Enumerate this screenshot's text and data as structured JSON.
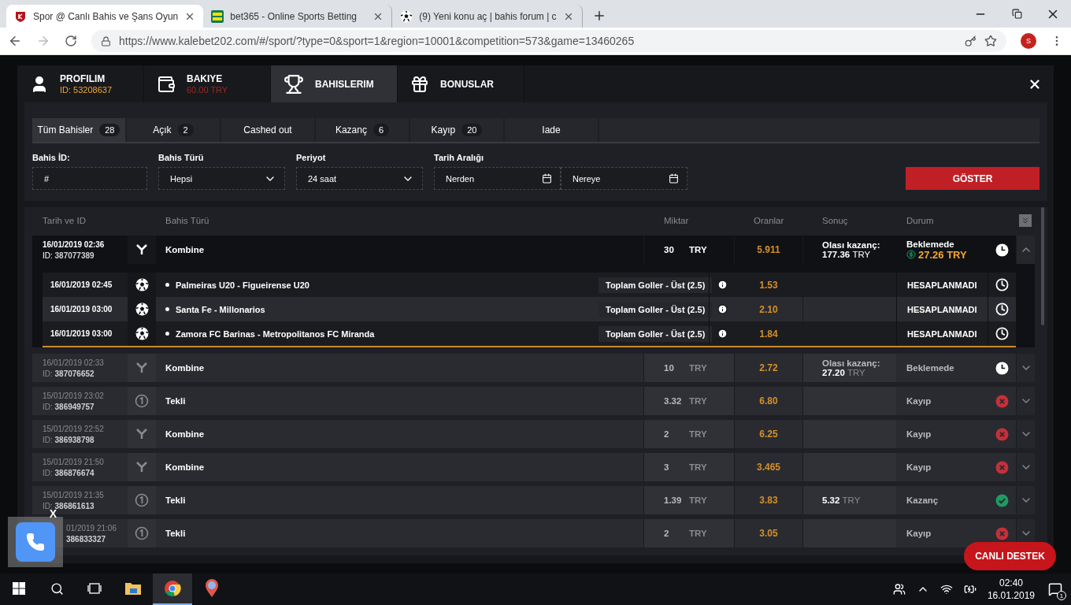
{
  "browser": {
    "tabs": [
      {
        "kind": "kale",
        "title": "Spor @ Canlı Bahis ve Şans Oyun",
        "selected": true
      },
      {
        "kind": "bet365",
        "title": "bet365 - Online Sports Betting",
        "selected": false
      },
      {
        "kind": "ball",
        "title": "(9) Yeni konu aç | bahis forum | c",
        "selected": false
      }
    ],
    "url": "https://www.kalebet202.com/#/sport/?type=0&sport=1&region=10001&competition=573&game=13460265",
    "profile_initial": "S"
  },
  "header_tabs": [
    {
      "kind": "profile",
      "label": "PROFILIM",
      "sub": "ID: 53208637",
      "selected": false
    },
    {
      "kind": "balance",
      "label": "BAKIYE",
      "sub": "60.00 TRY",
      "selected": false
    },
    {
      "kind": "bets",
      "label": "BAHISLERIM",
      "selected": true
    },
    {
      "kind": "bonus",
      "label": "BONUSLAR",
      "selected": false
    }
  ],
  "filter_tabs": [
    {
      "label": "Tüm Bahisler",
      "count": "28",
      "selected": true
    },
    {
      "label": "Açık",
      "count": "2",
      "selected": false
    },
    {
      "label": "Cashed out",
      "selected": false
    },
    {
      "label": "Kazanç",
      "count": "6",
      "selected": false
    },
    {
      "label": "Kayıp",
      "count": "20",
      "selected": false
    },
    {
      "label": "Iade",
      "selected": false
    }
  ],
  "filters": [
    {
      "kind": "text",
      "label": "Bahis İD:",
      "value": "#"
    },
    {
      "kind": "select",
      "label": "Bahis Türü",
      "value": "Hepsi"
    },
    {
      "kind": "select",
      "label": "Periyot",
      "value": "24 saat"
    },
    {
      "kind": "range",
      "label": "Tarih Aralığı",
      "from": "Nerden",
      "to": "Nereye"
    }
  ],
  "show_button": "GÖSTER",
  "table": {
    "columns": [
      "Tarih ve ID",
      "Bahis Türü",
      "Miktar",
      "Oranlar",
      "Sonuç",
      "Durum"
    ],
    "rows": [
      {
        "date": "16/01/2019 02:36",
        "id_label": "ID:",
        "id": "387077389",
        "kind": "combo",
        "type": "Kombine",
        "amount": "30",
        "currency": "TRY",
        "odds": "5.911",
        "result_label": "Olası kazanç:",
        "result_amount": "177.36",
        "result_currency": "TRY",
        "status": {
          "text": "Beklemede",
          "kind": "pending"
        },
        "cashout": "27.26 TRY",
        "expanded": true,
        "cut": false,
        "legs": [
          {
            "date": "16/01/2019 02:45",
            "match": "Palmeiras U20 - Figueirense U20",
            "market": "Toplam Goller - Üst (2.5)",
            "odds": "1.53",
            "status": "HESAPLANMADI",
            "highlighted": false
          },
          {
            "date": "16/01/2019 03:00",
            "match": "Santa Fe - Millonarios",
            "market": "Toplam Goller - Üst (2.5)",
            "odds": "2.10",
            "status": "HESAPLANMADI",
            "highlighted": true
          },
          {
            "date": "16/01/2019 03:00",
            "match": "Zamora FC Barinas - Metropolitanos FC Miranda",
            "market": "Toplam Goller - Üst (2.5)",
            "odds": "1.84",
            "status": "HESAPLANMADI",
            "highlighted": false
          }
        ]
      },
      {
        "date": "16/01/2019 02:33",
        "id_label": "ID:",
        "id": "387076652",
        "kind": "combo",
        "type": "Kombine",
        "amount": "10",
        "currency": "TRY",
        "odds": "2.72",
        "result_label": "Olası kazanç:",
        "result_amount": "27.20",
        "result_currency": "TRY",
        "status": {
          "text": "Beklemede",
          "kind": "pending"
        },
        "expanded": false,
        "cut": false
      },
      {
        "date": "15/01/2019 23:02",
        "id_label": "ID:",
        "id": "386949757",
        "kind": "single",
        "type": "Tekli",
        "amount": "3.32",
        "currency": "TRY",
        "odds": "6.80",
        "status": {
          "text": "Kayıp",
          "kind": "lost"
        },
        "expanded": false,
        "cut": false
      },
      {
        "date": "15/01/2019 22:52",
        "id_label": "ID:",
        "id": "386938798",
        "kind": "combo",
        "type": "Kombine",
        "amount": "2",
        "currency": "TRY",
        "odds": "6.25",
        "status": {
          "text": "Kayıp",
          "kind": "lost"
        },
        "expanded": false,
        "cut": false
      },
      {
        "date": "15/01/2019 21:50",
        "id_label": "ID:",
        "id": "386876674",
        "kind": "combo",
        "type": "Kombine",
        "amount": "3",
        "currency": "TRY",
        "odds": "3.465",
        "status": {
          "text": "Kayıp",
          "kind": "lost"
        },
        "expanded": false,
        "cut": false
      },
      {
        "date": "15/01/2019 21:35",
        "id_label": "ID:",
        "id": "386861613",
        "kind": "single",
        "type": "Tekli",
        "amount": "1.39",
        "currency": "TRY",
        "odds": "3.83",
        "result_amount": "5.32",
        "result_currency": "TRY",
        "status": {
          "text": "Kazanç",
          "kind": "won"
        },
        "expanded": false,
        "cut": false
      },
      {
        "date": "01/2019 21:06",
        "id": "386833327",
        "kind": "single",
        "type": "Tekli",
        "amount": "2",
        "currency": "TRY",
        "odds": "3.05",
        "status": {
          "text": "Kayıp",
          "kind": "lost"
        },
        "expanded": false,
        "cut": true
      }
    ]
  },
  "call_widget": {
    "close": "X"
  },
  "support_button": "CANLI DESTEK",
  "taskbar": {
    "apps": [
      {
        "kind": "explorer",
        "selected": false
      },
      {
        "kind": "chrome",
        "selected": true
      },
      {
        "kind": "maps",
        "selected": false
      }
    ],
    "time": "02:40",
    "date": "16.01.2019",
    "notifications": "1"
  }
}
